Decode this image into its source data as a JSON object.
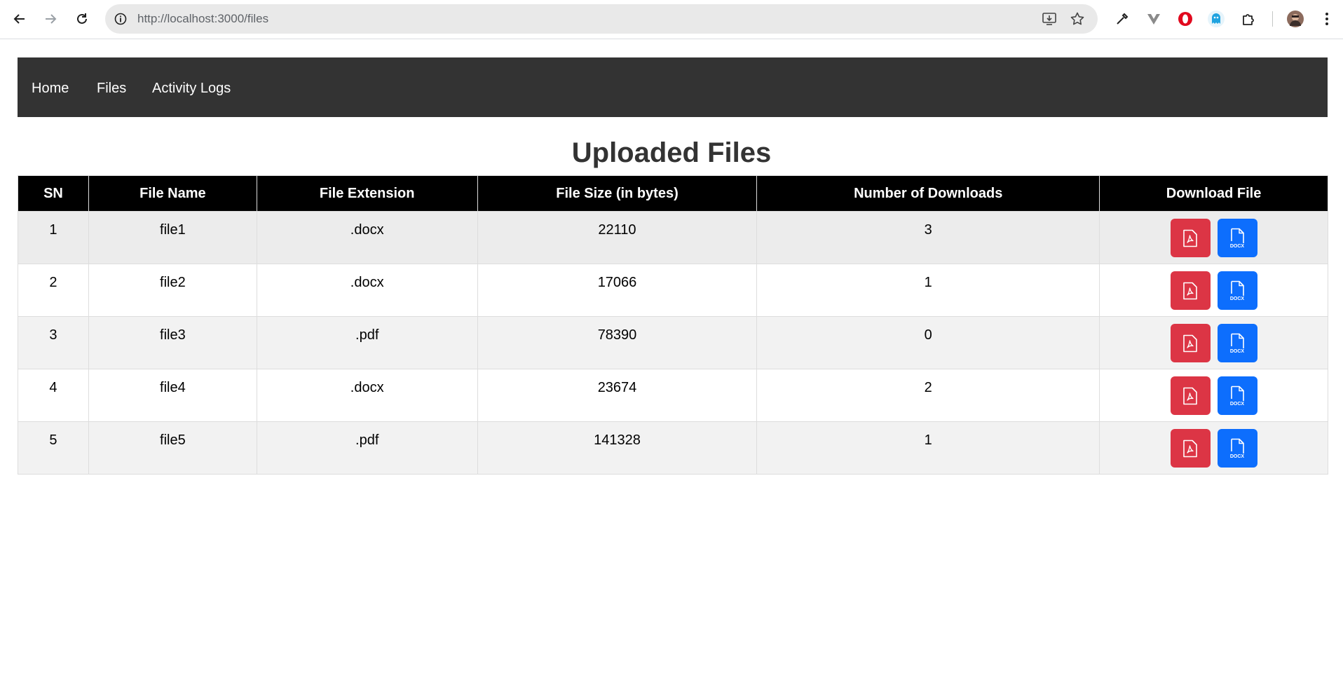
{
  "browser": {
    "url": "http://localhost:3000/files"
  },
  "navbar": {
    "items": [
      {
        "label": "Home"
      },
      {
        "label": "Files"
      },
      {
        "label": "Activity Logs"
      }
    ]
  },
  "page": {
    "title": "Uploaded Files"
  },
  "table": {
    "headers": [
      "SN",
      "File Name",
      "File Extension",
      "File Size (in bytes)",
      "Number of Downloads",
      "Download File"
    ],
    "rows": [
      {
        "sn": "1",
        "name": "file1",
        "ext": ".docx",
        "size": "22110",
        "downloads": "3"
      },
      {
        "sn": "2",
        "name": "file2",
        "ext": ".docx",
        "size": "17066",
        "downloads": "1"
      },
      {
        "sn": "3",
        "name": "file3",
        "ext": ".pdf",
        "size": "78390",
        "downloads": "0"
      },
      {
        "sn": "4",
        "name": "file4",
        "ext": ".docx",
        "size": "23674",
        "downloads": "2"
      },
      {
        "sn": "5",
        "name": "file5",
        "ext": ".pdf",
        "size": "141328",
        "downloads": "1"
      }
    ],
    "docx_icon_text": "DOCX"
  },
  "colors": {
    "navbar_bg": "#333333",
    "header_bg": "#000000",
    "pdf_button": "#dc3545",
    "docx_button": "#0d6efd"
  }
}
